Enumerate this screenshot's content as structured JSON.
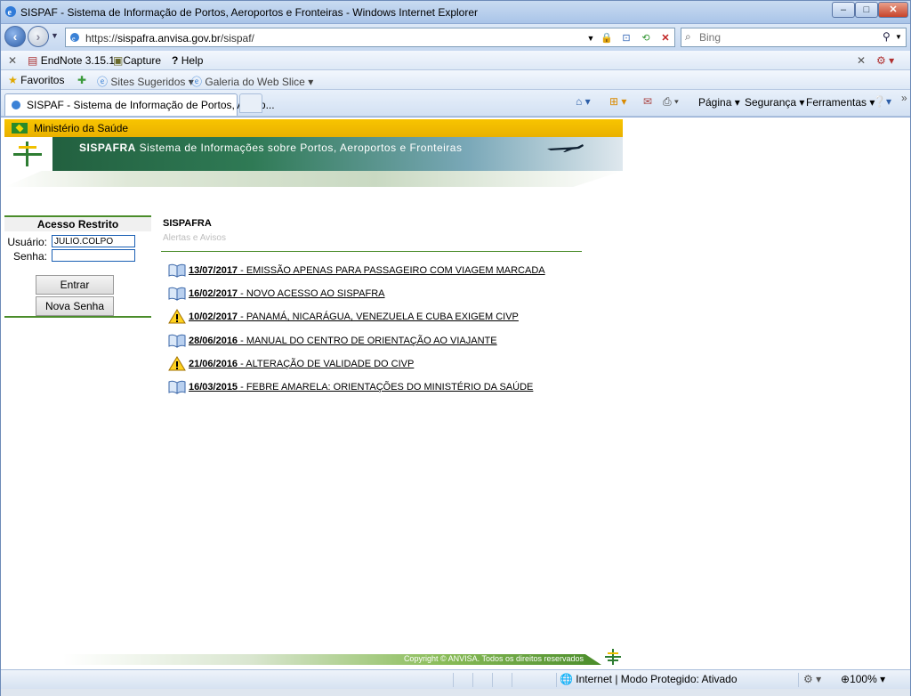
{
  "window": {
    "title": "SISPAF - Sistema de Informação de Portos, Aeroportos e Fronteiras - Windows Internet Explorer",
    "minimize": "–",
    "maximize": "□",
    "close": "✕"
  },
  "address": {
    "url_prefix": "https://",
    "url_host": "sispafra.anvisa.gov.br",
    "url_path": "/sispaf/",
    "search_placeholder": "Bing"
  },
  "toolbar1": {
    "endnote": "EndNote 3.15.1",
    "capture": "Capture",
    "help": "Help"
  },
  "favorites_bar": {
    "favorites": "Favoritos",
    "suggested": "Sites Sugeridos",
    "webslice": "Galeria do Web Slice"
  },
  "tab": {
    "label": "SISPAF - Sistema de Informação de Portos, Aerop..."
  },
  "command_bar": {
    "page": "Página",
    "security": "Segurança",
    "tools": "Ferramentas"
  },
  "site": {
    "ministry": "Ministério da Saúde",
    "banner_brand": "SISPAFRA",
    "banner_text": "Sistema de Informações sobre Portos, Aeroportos e Fronteiras"
  },
  "login": {
    "header": "Acesso Restrito",
    "user_label": "Usuário:",
    "user_value": "JULIO.COLPO",
    "password_label": "Senha:",
    "password_value": "",
    "enter_button": "Entrar",
    "new_password_button": "Nova Senha"
  },
  "news": {
    "title": "SISPAFRA",
    "subtitle": "Alertas e Avisos",
    "items": [
      {
        "date": "13/07/2017",
        "text": " - EMISSÃO APENAS PARA PASSAGEIRO COM VIAGEM MARCADA",
        "icon": "book-icon"
      },
      {
        "date": "16/02/2017",
        "text": " - NOVO ACESSO AO SISPAFRA",
        "icon": "book-icon"
      },
      {
        "date": "10/02/2017",
        "text": " - PANAMÁ, NICARÁGUA, VENEZUELA E CUBA EXIGEM CIVP",
        "icon": "warning-icon"
      },
      {
        "date": "28/06/2016",
        "text": " - MANUAL DO CENTRO DE ORIENTAÇÃO AO VIAJANTE",
        "icon": "book-icon"
      },
      {
        "date": "21/06/2016",
        "text": " - ALTERAÇÃO DE VALIDADE DO CIVP",
        "icon": "warning-icon"
      },
      {
        "date": "16/03/2015",
        "text": " - FEBRE AMARELA: ORIENTAÇÕES DO MINISTÉRIO DA SAÚDE",
        "icon": "book-icon"
      }
    ]
  },
  "footer": {
    "copyright": "Copyright © ANVISA. Todos os direitos reservados"
  },
  "statusbar": {
    "zone": "Internet | Modo Protegido: Ativado",
    "zoom": "100%"
  }
}
